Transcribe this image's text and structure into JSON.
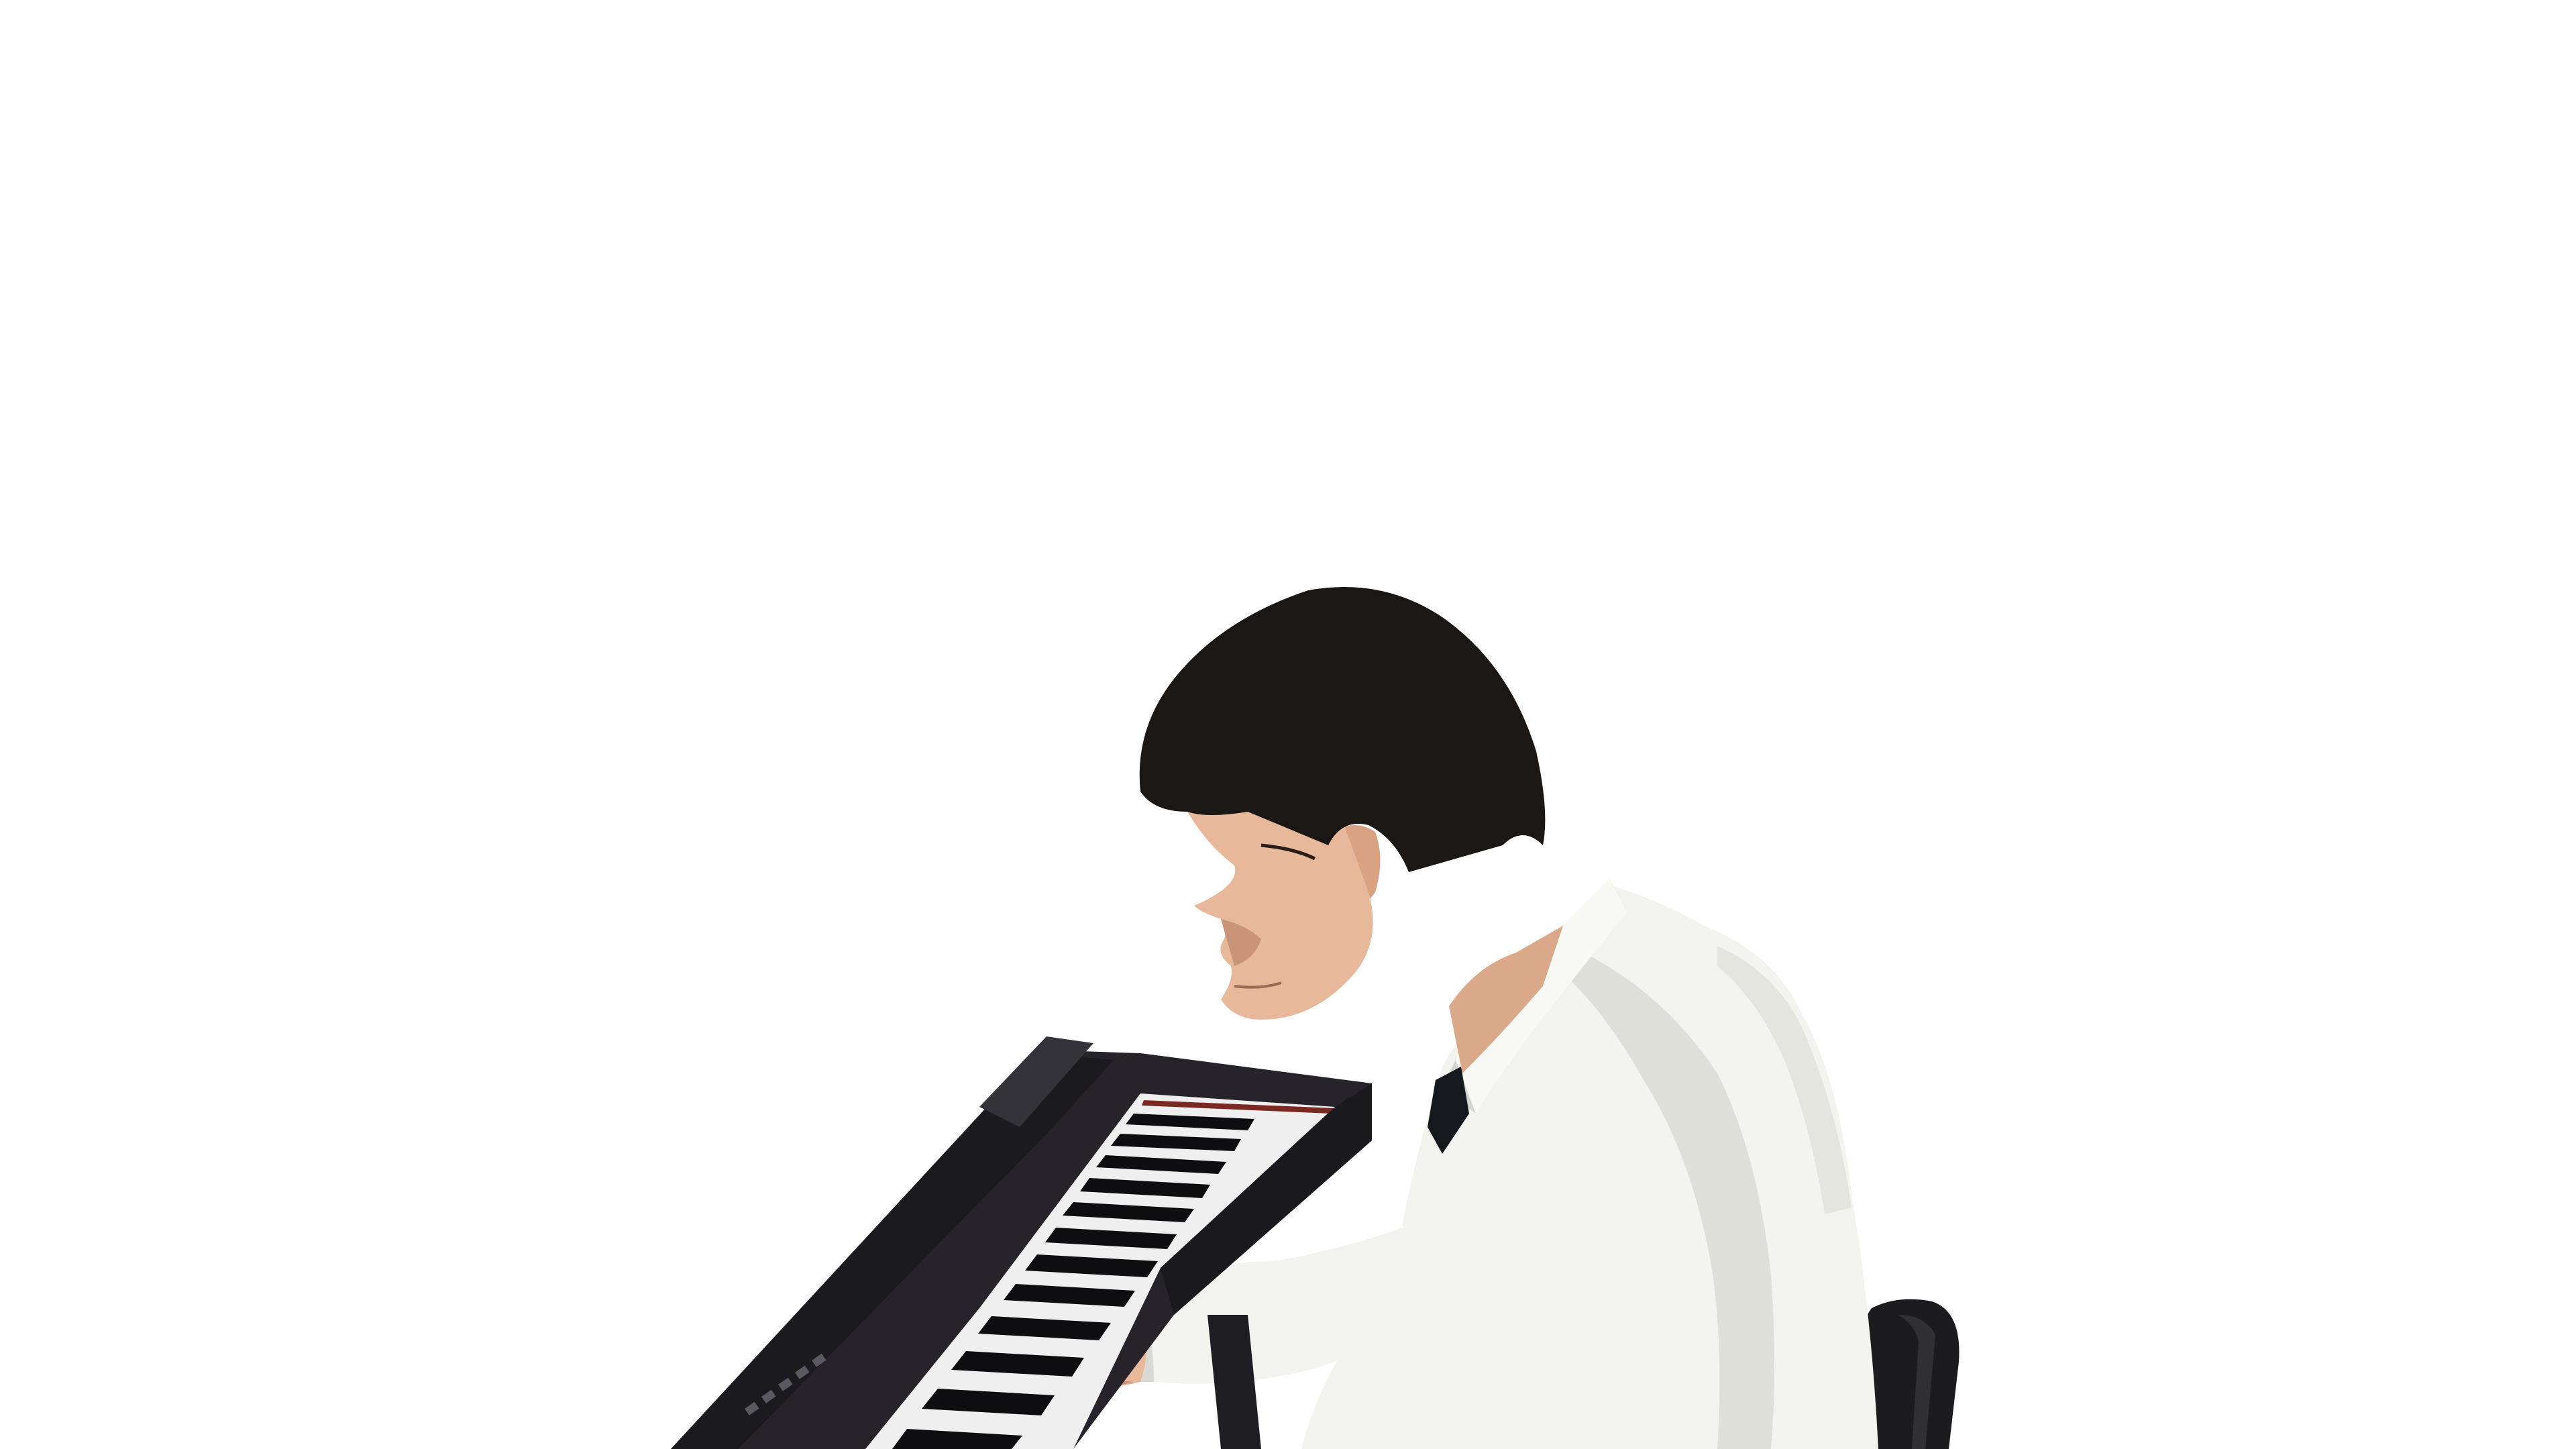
{
  "image": {
    "subject": "person-playing-keyboard",
    "background_color": "#ffffff",
    "colors": {
      "hair": "#1a1714",
      "skin": "#e8b89a",
      "skin_shadow": "#c99478",
      "shirt": "#f3f3ef",
      "shirt_shadow": "#d9dad4",
      "tie": "#15181c",
      "keyboard_body": "#26242a",
      "keyboard_panel": "#1b1a1f",
      "white_keys": "#efefef",
      "black_keys": "#0e0e10",
      "chair": "#1c1c1f"
    },
    "icons": [
      "keyboard-instrument",
      "chair"
    ]
  }
}
